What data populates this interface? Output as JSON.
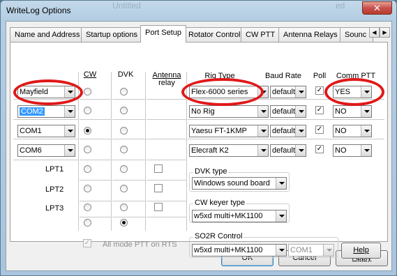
{
  "window": {
    "title": "WriteLog Options",
    "close_glyph": "✕",
    "faint_title_fragments": [
      "Untitled",
      "ed"
    ]
  },
  "tabs": [
    {
      "label": "Name and Address",
      "active": false
    },
    {
      "label": "Startup options",
      "active": false
    },
    {
      "label": "Port Setup",
      "active": true
    },
    {
      "label": "Rotator Control",
      "active": false
    },
    {
      "label": "CW PTT",
      "active": false
    },
    {
      "label": "Antenna Relays",
      "active": false
    },
    {
      "label": "Sounc",
      "active": false
    }
  ],
  "tab_scroll": {
    "left_icon": "chevron-left-icon",
    "right_icon": "chevron-right-icon",
    "left_glyph": "◀",
    "right_glyph": "▶"
  },
  "headers": {
    "cw": "CW",
    "dvk": "DVK",
    "antenna_relay_line1": "Antenna",
    "antenna_relay_line2": "relay",
    "rig_type": "Rig Type",
    "baud_rate": "Baud Rate",
    "poll": "Poll",
    "comm_ptt": "Comm PTT"
  },
  "rows": [
    {
      "port": "Mayfield",
      "port_selected": false,
      "cw": false,
      "dvk": false,
      "rig": "Flex-6000 series",
      "baud": "default",
      "poll": true,
      "comm_ptt": "YES"
    },
    {
      "port": "COM2",
      "port_selected": true,
      "cw": false,
      "dvk": false,
      "rig": "No Rig",
      "baud": "default",
      "poll": true,
      "comm_ptt": "NO"
    },
    {
      "port": "COM1",
      "port_selected": false,
      "cw": true,
      "dvk": false,
      "rig": "Yaesu FT-1KMP",
      "baud": "default",
      "poll": true,
      "comm_ptt": "NO"
    },
    {
      "port": "COM6",
      "port_selected": false,
      "cw": false,
      "dvk": false,
      "rig": "Elecraft K2",
      "baud": "default",
      "poll": true,
      "comm_ptt": "NO"
    }
  ],
  "lpt_rows": [
    {
      "label": "LPT1",
      "cw": false,
      "dvk": false,
      "relay": false
    },
    {
      "label": "LPT2",
      "cw": false,
      "dvk": false,
      "relay": false
    },
    {
      "label": "LPT3",
      "cw": false,
      "dvk": false,
      "relay": false
    }
  ],
  "none_row": {
    "cw": false,
    "dvk": true
  },
  "all_mode_ptt": {
    "label": "All mode PTT on RTS",
    "checked": true,
    "disabled": true
  },
  "dvk_type": {
    "label": "DVK type",
    "value": "Windows sound board"
  },
  "cw_keyer_type": {
    "label": "CW keyer type",
    "value": "w5xd multi+MK1100"
  },
  "so2r_control": {
    "label": "SO2R Control",
    "value": "w5xd multi+MK1100",
    "port": "COM1"
  },
  "buttons": {
    "help": "Help",
    "ok": "OK",
    "cancel": "Cancel",
    "apply": "Apply"
  },
  "annotation_color": "#e01818"
}
